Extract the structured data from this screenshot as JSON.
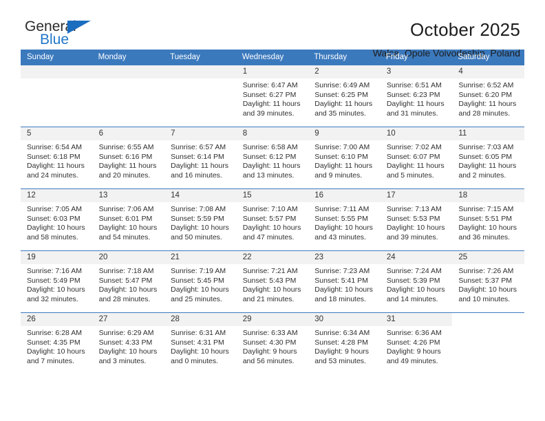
{
  "brand": {
    "name_primary": "General",
    "name_secondary": "Blue",
    "triangle_icon": "triangle-icon",
    "colors": {
      "primary_text": "#2b2b2b",
      "accent": "#2076c9",
      "triangle": "#1b6dc0"
    }
  },
  "header": {
    "title": "October 2025",
    "subtitle": "Walce, Opole Voivodeship, Poland"
  },
  "theme": {
    "header_blue": "#3b79bd",
    "daynum_band": "#f2f2f2",
    "text": "#2f2f2f"
  },
  "weekdays": [
    "Sunday",
    "Monday",
    "Tuesday",
    "Wednesday",
    "Thursday",
    "Friday",
    "Saturday"
  ],
  "labels": {
    "sunrise": "Sunrise:",
    "sunset": "Sunset:",
    "daylight": "Daylight:"
  },
  "weeks": [
    [
      {
        "day": "",
        "blank": false,
        "lines": []
      },
      {
        "day": "",
        "blank": false,
        "lines": []
      },
      {
        "day": "",
        "blank": false,
        "lines": []
      },
      {
        "day": "1",
        "blank": false,
        "lines": [
          "Sunrise: 6:47 AM",
          "Sunset: 6:27 PM",
          "Daylight: 11 hours",
          "and 39 minutes."
        ]
      },
      {
        "day": "2",
        "blank": false,
        "lines": [
          "Sunrise: 6:49 AM",
          "Sunset: 6:25 PM",
          "Daylight: 11 hours",
          "and 35 minutes."
        ]
      },
      {
        "day": "3",
        "blank": false,
        "lines": [
          "Sunrise: 6:51 AM",
          "Sunset: 6:23 PM",
          "Daylight: 11 hours",
          "and 31 minutes."
        ]
      },
      {
        "day": "4",
        "blank": false,
        "lines": [
          "Sunrise: 6:52 AM",
          "Sunset: 6:20 PM",
          "Daylight: 11 hours",
          "and 28 minutes."
        ]
      }
    ],
    [
      {
        "day": "5",
        "blank": false,
        "lines": [
          "Sunrise: 6:54 AM",
          "Sunset: 6:18 PM",
          "Daylight: 11 hours",
          "and 24 minutes."
        ]
      },
      {
        "day": "6",
        "blank": false,
        "lines": [
          "Sunrise: 6:55 AM",
          "Sunset: 6:16 PM",
          "Daylight: 11 hours",
          "and 20 minutes."
        ]
      },
      {
        "day": "7",
        "blank": false,
        "lines": [
          "Sunrise: 6:57 AM",
          "Sunset: 6:14 PM",
          "Daylight: 11 hours",
          "and 16 minutes."
        ]
      },
      {
        "day": "8",
        "blank": false,
        "lines": [
          "Sunrise: 6:58 AM",
          "Sunset: 6:12 PM",
          "Daylight: 11 hours",
          "and 13 minutes."
        ]
      },
      {
        "day": "9",
        "blank": false,
        "lines": [
          "Sunrise: 7:00 AM",
          "Sunset: 6:10 PM",
          "Daylight: 11 hours",
          "and 9 minutes."
        ]
      },
      {
        "day": "10",
        "blank": false,
        "lines": [
          "Sunrise: 7:02 AM",
          "Sunset: 6:07 PM",
          "Daylight: 11 hours",
          "and 5 minutes."
        ]
      },
      {
        "day": "11",
        "blank": false,
        "lines": [
          "Sunrise: 7:03 AM",
          "Sunset: 6:05 PM",
          "Daylight: 11 hours",
          "and 2 minutes."
        ]
      }
    ],
    [
      {
        "day": "12",
        "blank": false,
        "lines": [
          "Sunrise: 7:05 AM",
          "Sunset: 6:03 PM",
          "Daylight: 10 hours",
          "and 58 minutes."
        ]
      },
      {
        "day": "13",
        "blank": false,
        "lines": [
          "Sunrise: 7:06 AM",
          "Sunset: 6:01 PM",
          "Daylight: 10 hours",
          "and 54 minutes."
        ]
      },
      {
        "day": "14",
        "blank": false,
        "lines": [
          "Sunrise: 7:08 AM",
          "Sunset: 5:59 PM",
          "Daylight: 10 hours",
          "and 50 minutes."
        ]
      },
      {
        "day": "15",
        "blank": false,
        "lines": [
          "Sunrise: 7:10 AM",
          "Sunset: 5:57 PM",
          "Daylight: 10 hours",
          "and 47 minutes."
        ]
      },
      {
        "day": "16",
        "blank": false,
        "lines": [
          "Sunrise: 7:11 AM",
          "Sunset: 5:55 PM",
          "Daylight: 10 hours",
          "and 43 minutes."
        ]
      },
      {
        "day": "17",
        "blank": false,
        "lines": [
          "Sunrise: 7:13 AM",
          "Sunset: 5:53 PM",
          "Daylight: 10 hours",
          "and 39 minutes."
        ]
      },
      {
        "day": "18",
        "blank": false,
        "lines": [
          "Sunrise: 7:15 AM",
          "Sunset: 5:51 PM",
          "Daylight: 10 hours",
          "and 36 minutes."
        ]
      }
    ],
    [
      {
        "day": "19",
        "blank": false,
        "lines": [
          "Sunrise: 7:16 AM",
          "Sunset: 5:49 PM",
          "Daylight: 10 hours",
          "and 32 minutes."
        ]
      },
      {
        "day": "20",
        "blank": false,
        "lines": [
          "Sunrise: 7:18 AM",
          "Sunset: 5:47 PM",
          "Daylight: 10 hours",
          "and 28 minutes."
        ]
      },
      {
        "day": "21",
        "blank": false,
        "lines": [
          "Sunrise: 7:19 AM",
          "Sunset: 5:45 PM",
          "Daylight: 10 hours",
          "and 25 minutes."
        ]
      },
      {
        "day": "22",
        "blank": false,
        "lines": [
          "Sunrise: 7:21 AM",
          "Sunset: 5:43 PM",
          "Daylight: 10 hours",
          "and 21 minutes."
        ]
      },
      {
        "day": "23",
        "blank": false,
        "lines": [
          "Sunrise: 7:23 AM",
          "Sunset: 5:41 PM",
          "Daylight: 10 hours",
          "and 18 minutes."
        ]
      },
      {
        "day": "24",
        "blank": false,
        "lines": [
          "Sunrise: 7:24 AM",
          "Sunset: 5:39 PM",
          "Daylight: 10 hours",
          "and 14 minutes."
        ]
      },
      {
        "day": "25",
        "blank": false,
        "lines": [
          "Sunrise: 7:26 AM",
          "Sunset: 5:37 PM",
          "Daylight: 10 hours",
          "and 10 minutes."
        ]
      }
    ],
    [
      {
        "day": "26",
        "blank": false,
        "lines": [
          "Sunrise: 6:28 AM",
          "Sunset: 4:35 PM",
          "Daylight: 10 hours",
          "and 7 minutes."
        ]
      },
      {
        "day": "27",
        "blank": false,
        "lines": [
          "Sunrise: 6:29 AM",
          "Sunset: 4:33 PM",
          "Daylight: 10 hours",
          "and 3 minutes."
        ]
      },
      {
        "day": "28",
        "blank": false,
        "lines": [
          "Sunrise: 6:31 AM",
          "Sunset: 4:31 PM",
          "Daylight: 10 hours",
          "and 0 minutes."
        ]
      },
      {
        "day": "29",
        "blank": false,
        "lines": [
          "Sunrise: 6:33 AM",
          "Sunset: 4:30 PM",
          "Daylight: 9 hours",
          "and 56 minutes."
        ]
      },
      {
        "day": "30",
        "blank": false,
        "lines": [
          "Sunrise: 6:34 AM",
          "Sunset: 4:28 PM",
          "Daylight: 9 hours",
          "and 53 minutes."
        ]
      },
      {
        "day": "31",
        "blank": false,
        "lines": [
          "Sunrise: 6:36 AM",
          "Sunset: 4:26 PM",
          "Daylight: 9 hours",
          "and 49 minutes."
        ]
      },
      {
        "day": "",
        "blank": true,
        "lines": []
      }
    ]
  ]
}
